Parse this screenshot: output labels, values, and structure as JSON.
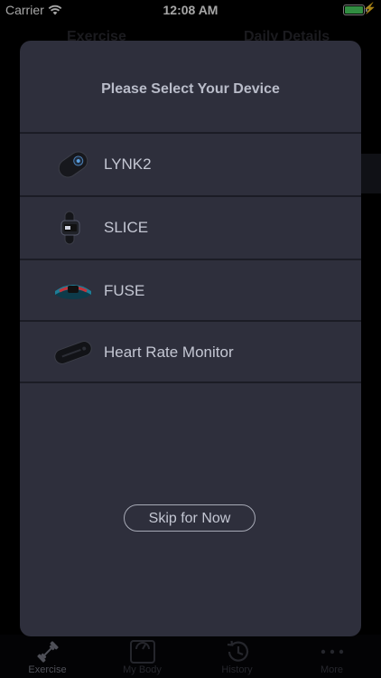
{
  "status_bar": {
    "carrier": "Carrier",
    "time": "12:08 AM",
    "battery_color": "#4cd964"
  },
  "background": {
    "tabs": [
      "Exercise",
      "Daily Details"
    ]
  },
  "tab_bar": {
    "items": [
      {
        "label": "Exercise",
        "icon": "dumbbell-icon",
        "active": true
      },
      {
        "label": "My Body",
        "icon": "scale-icon",
        "active": false
      },
      {
        "label": "History",
        "icon": "history-clock-icon",
        "active": false
      },
      {
        "label": "More",
        "icon": "more-dots-icon",
        "active": false
      }
    ]
  },
  "modal": {
    "title": "Please Select Your Device",
    "devices": [
      {
        "name": "LYNK2",
        "image": "lynk2-device-image"
      },
      {
        "name": "SLICE",
        "image": "slice-device-image"
      },
      {
        "name": "FUSE",
        "image": "fuse-device-image"
      },
      {
        "name": "Heart Rate Monitor",
        "image": "heart-rate-monitor-image"
      }
    ],
    "skip_label": "Skip for Now",
    "colors": {
      "background": "#2e2f3c",
      "text": "#c4c7d3",
      "separator": "#1b1c25"
    }
  }
}
